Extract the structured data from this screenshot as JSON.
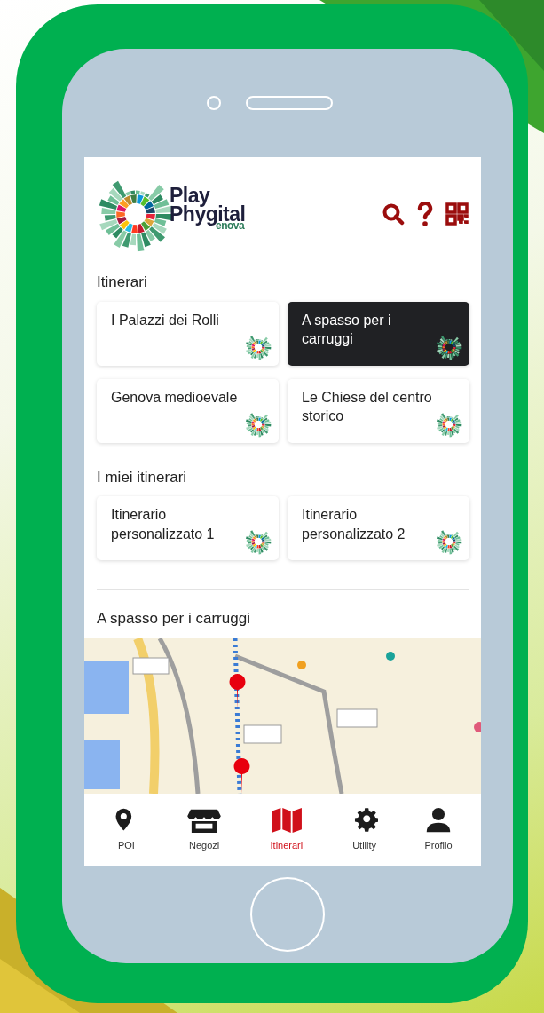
{
  "header": {
    "logo_lines": [
      "Play",
      "Phygital",
      "enova"
    ]
  },
  "sections": [
    {
      "title": "Itinerari",
      "cards": [
        {
          "label": "I Palazzi dei Rolli",
          "selected": false
        },
        {
          "label": "A spasso per i carruggi",
          "selected": true
        },
        {
          "label": "Genova medioevale",
          "selected": false
        },
        {
          "label": "Le Chiese del centro storico",
          "selected": false
        }
      ]
    },
    {
      "title": "I miei itinerari",
      "cards": [
        {
          "label": "Itinerario personalizzato 1",
          "selected": false
        },
        {
          "label": "Itinerario personalizzato 2",
          "selected": false
        }
      ]
    }
  ],
  "map_section": {
    "title": "A spasso per i carruggi"
  },
  "nav": [
    {
      "label": "POI",
      "kind": "pin",
      "selected": false
    },
    {
      "label": "Negozi",
      "kind": "store",
      "selected": false
    },
    {
      "label": "Itinerari",
      "kind": "map",
      "selected": true
    },
    {
      "label": "Utility",
      "kind": "gear",
      "selected": false
    },
    {
      "label": "Profilo",
      "kind": "person",
      "selected": false
    }
  ]
}
